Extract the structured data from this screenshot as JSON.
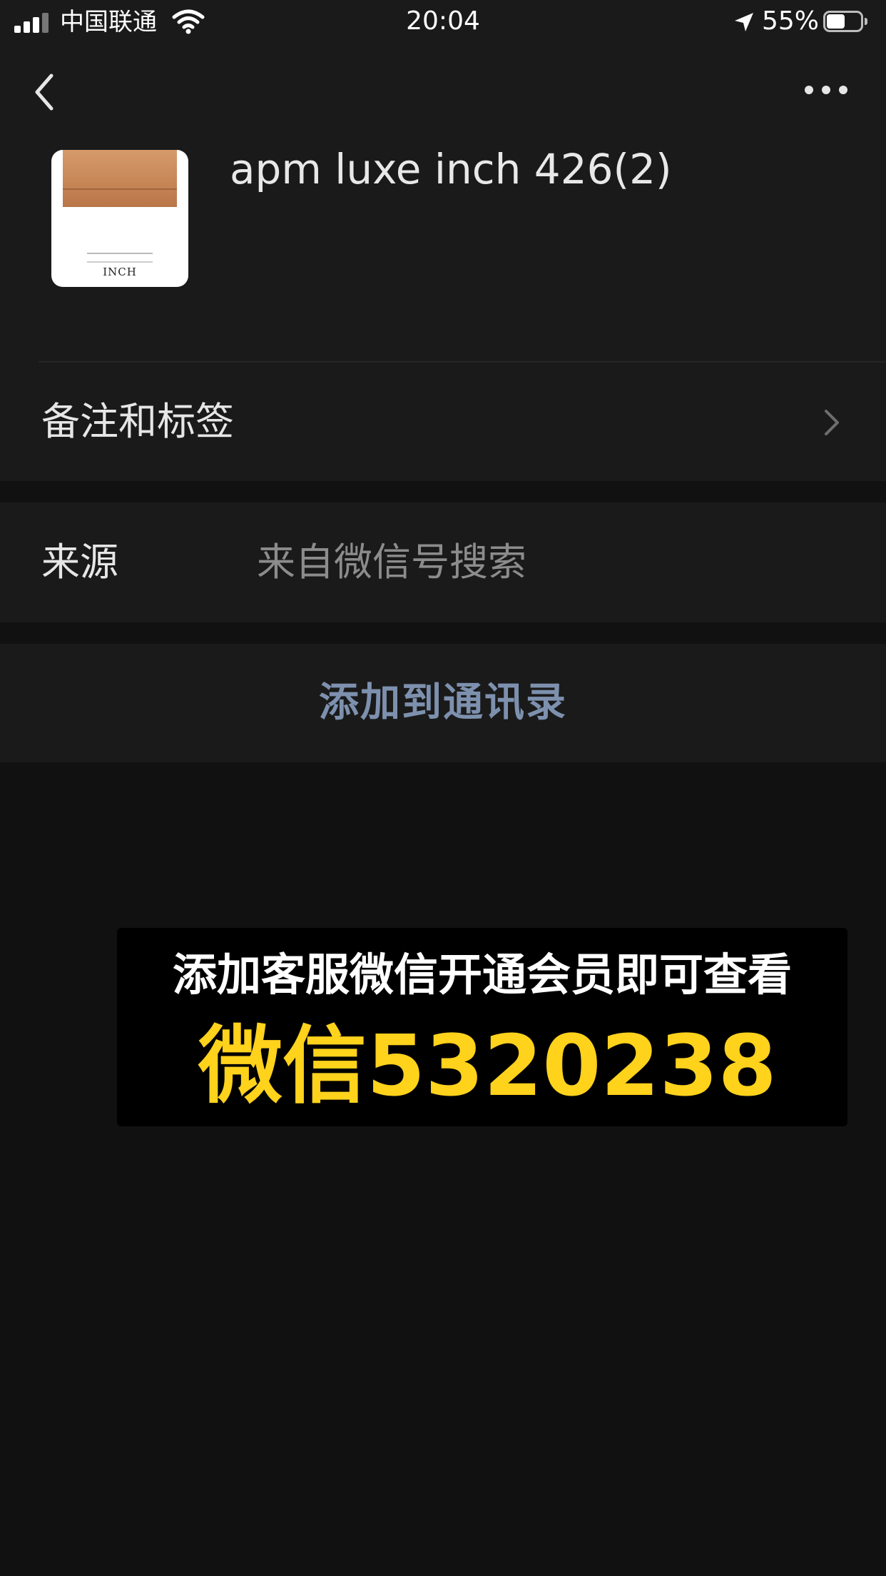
{
  "status_bar": {
    "carrier": "中国联通",
    "time": "20:04",
    "battery_percent": "55%",
    "battery_level": 0.55,
    "icons": [
      "signal-icon",
      "wifi-icon",
      "location-icon",
      "battery-icon"
    ]
  },
  "navigation": {
    "back_icon": "chevron-left-icon",
    "more_icon": "more-dots-icon"
  },
  "contact": {
    "name": "apm luxe inch 426(2)",
    "avatar": {
      "logo_text": "INCH"
    }
  },
  "rows": {
    "remark": {
      "label": "备注和标签",
      "icon": "chevron-right-icon"
    },
    "source": {
      "label": "来源",
      "value": "来自微信号搜索"
    },
    "add_contact": {
      "label": "添加到通讯录",
      "color": "#7d90ae"
    }
  },
  "promo": {
    "line1": "添加客服微信开通会员即可查看",
    "line2": "微信5320238",
    "line2_color": "#ffd21c"
  },
  "colors": {
    "background": "#111111",
    "surface": "#1a1a1a",
    "text_primary": "#e6e6e6",
    "text_secondary": "#8c8c8c"
  }
}
